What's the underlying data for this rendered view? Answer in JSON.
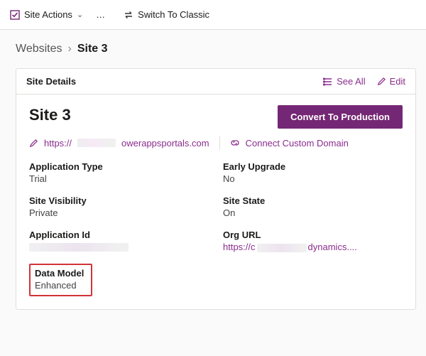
{
  "topbar": {
    "site_actions_label": "Site Actions",
    "switch_classic_label": "Switch To Classic"
  },
  "breadcrumb": {
    "parent": "Websites",
    "current": "Site 3"
  },
  "card": {
    "header": {
      "title": "Site Details",
      "see_all_label": "See All",
      "edit_label": "Edit"
    },
    "title": "Site 3",
    "convert_button_label": "Convert To Production",
    "url": {
      "prefix": "https://",
      "suffix": "owerappsportals.com"
    },
    "connect_domain_label": "Connect Custom Domain",
    "fields": {
      "application_type": {
        "label": "Application Type",
        "value": "Trial"
      },
      "early_upgrade": {
        "label": "Early Upgrade",
        "value": "No"
      },
      "site_visibility": {
        "label": "Site Visibility",
        "value": "Private"
      },
      "site_state": {
        "label": "Site State",
        "value": "On"
      },
      "application_id": {
        "label": "Application Id"
      },
      "org_url": {
        "label": "Org URL",
        "prefix": "https://c",
        "suffix": "dynamics...."
      },
      "data_model": {
        "label": "Data Model",
        "value": "Enhanced"
      }
    }
  }
}
